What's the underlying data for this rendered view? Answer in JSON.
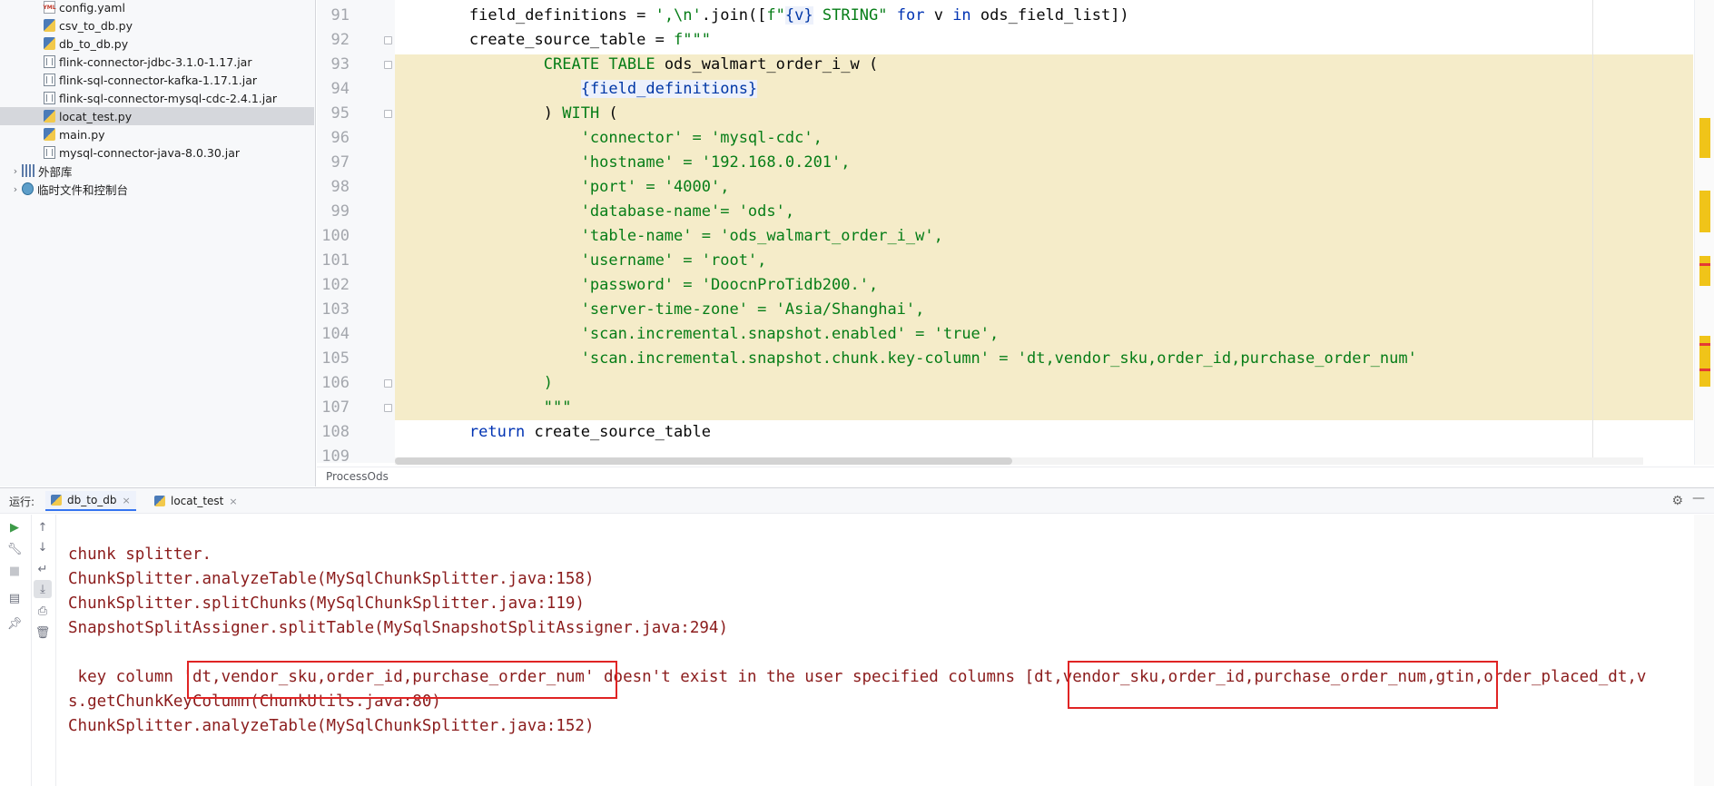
{
  "project_tree": {
    "items": [
      {
        "label": "config.yaml",
        "icon": "yaml-file-icon",
        "kind": "yaml",
        "indent": 2,
        "selected": false
      },
      {
        "label": "csv_to_db.py",
        "icon": "python-file-icon",
        "kind": "py",
        "indent": 2,
        "selected": false
      },
      {
        "label": "db_to_db.py",
        "icon": "python-file-icon",
        "kind": "py",
        "indent": 2,
        "selected": false
      },
      {
        "label": "flink-connector-jdbc-3.1.0-1.17.jar",
        "icon": "jar-file-icon",
        "kind": "jar",
        "indent": 2,
        "selected": false
      },
      {
        "label": "flink-sql-connector-kafka-1.17.1.jar",
        "icon": "jar-file-icon",
        "kind": "jar",
        "indent": 2,
        "selected": false
      },
      {
        "label": "flink-sql-connector-mysql-cdc-2.4.1.jar",
        "icon": "jar-file-icon",
        "kind": "jar",
        "indent": 2,
        "selected": false
      },
      {
        "label": "locat_test.py",
        "icon": "python-file-icon",
        "kind": "py",
        "indent": 2,
        "selected": true
      },
      {
        "label": "main.py",
        "icon": "python-file-icon",
        "kind": "py",
        "indent": 2,
        "selected": false
      },
      {
        "label": "mysql-connector-java-8.0.30.jar",
        "icon": "jar-file-icon",
        "kind": "jar",
        "indent": 2,
        "selected": false
      },
      {
        "label": "外部库",
        "icon": "library-icon",
        "kind": "lib",
        "indent": 1,
        "selected": false,
        "expandable": true
      },
      {
        "label": "临时文件和控制台",
        "icon": "scratches-icon",
        "kind": "scratch",
        "indent": 1,
        "selected": false,
        "expandable": true
      }
    ]
  },
  "editor": {
    "breadcrumb": "ProcessOds",
    "highlighted_block": {
      "from_line": 93,
      "to_line": 107
    },
    "lines": [
      {
        "number": "91",
        "tokens": [
          [
            "",
            "        field_definitions = "
          ],
          [
            "str",
            "',\\n'"
          ],
          [
            "",
            ".join(["
          ],
          [
            "fstr",
            "f\""
          ],
          [
            "interp",
            "{v}"
          ],
          [
            "fstr",
            " STRING\""
          ],
          [
            "kw",
            " for "
          ],
          [
            "",
            "v "
          ],
          [
            "kw",
            "in"
          ],
          [
            "",
            " ods_field_list])"
          ]
        ]
      },
      {
        "number": "92",
        "tokens": [
          [
            "",
            "        create_source_table = "
          ],
          [
            "fstr",
            "f\"\"\""
          ]
        ]
      },
      {
        "number": "93",
        "tokens": [
          [
            "str",
            "                CREATE TABLE "
          ],
          [
            "",
            "ods_walmart_order_i_w ("
          ]
        ]
      },
      {
        "number": "94",
        "tokens": [
          [
            "",
            "                    "
          ],
          [
            "interp",
            "{field_definitions}"
          ]
        ]
      },
      {
        "number": "95",
        "tokens": [
          [
            "",
            "                ) "
          ],
          [
            "str",
            "WITH"
          ],
          [
            "",
            " ("
          ]
        ]
      },
      {
        "number": "96",
        "tokens": [
          [
            "str",
            "                    'connector' = 'mysql-cdc',"
          ]
        ]
      },
      {
        "number": "97",
        "tokens": [
          [
            "str",
            "                    'hostname' = '192.168.0.201',"
          ]
        ]
      },
      {
        "number": "98",
        "tokens": [
          [
            "str",
            "                    'port' = '4000',"
          ]
        ]
      },
      {
        "number": "99",
        "tokens": [
          [
            "str",
            "                    'database-name'= 'ods',"
          ]
        ]
      },
      {
        "number": "100",
        "tokens": [
          [
            "str",
            "                    'table-name' = 'ods_walmart_order_i_w',"
          ]
        ]
      },
      {
        "number": "101",
        "tokens": [
          [
            "str",
            "                    'username' = 'root',"
          ]
        ]
      },
      {
        "number": "102",
        "tokens": [
          [
            "str",
            "                    'password' = 'DoocnProTidb200.',"
          ]
        ]
      },
      {
        "number": "103",
        "tokens": [
          [
            "str",
            "                    'server-time-zone' = 'Asia/Shanghai',"
          ]
        ]
      },
      {
        "number": "104",
        "tokens": [
          [
            "str",
            "                    'scan.incremental.snapshot.enabled' = 'true',"
          ]
        ]
      },
      {
        "number": "105",
        "tokens": [
          [
            "str",
            "                    'scan.incremental.snapshot.chunk.key-column' = 'dt,vendor_sku,order_id,purchase_order_num'"
          ]
        ]
      },
      {
        "number": "106",
        "tokens": [
          [
            "str",
            "                )"
          ]
        ]
      },
      {
        "number": "107",
        "tokens": [
          [
            "str",
            "                "
          ],
          [
            "fstr",
            "\"\"\""
          ]
        ]
      },
      {
        "number": "108",
        "tokens": [
          [
            "kw",
            "        return "
          ],
          [
            "",
            "create_source_table"
          ]
        ]
      },
      {
        "number": "109",
        "tokens": []
      }
    ]
  },
  "run_panel": {
    "label": "运行:",
    "tabs": [
      {
        "label": "db_to_db",
        "active": true
      },
      {
        "label": "locat_test",
        "active": false
      }
    ],
    "console_lines": [
      {
        "text": "chunk splitter."
      },
      {
        "text": "ChunkSplitter.analyzeTable(MySqlChunkSplitter.java:158)"
      },
      {
        "text": "ChunkSplitter.splitChunks(MySqlChunkSplitter.java:119)"
      },
      {
        "text": "SnapshotSplitAssigner.splitTable(MySqlSnapshotSplitAssigner.java:294)"
      },
      {
        "text": ""
      },
      {
        "text": " key column 'dt,vendor_sku,order_id,purchase_order_num' doesn't exist in the user specified columns [dt,vendor_sku,order_id,purchase_order_num,gtin,order_placed_dt,v"
      },
      {
        "text": "s.getChunkKeyColumn(ChunkUtils.java:80)"
      },
      {
        "text": "ChunkSplitter.analyzeTable(MySqlChunkSplitter.java:152)"
      }
    ]
  },
  "colors": {
    "keyword": "#0033b3",
    "string": "#067d17",
    "error_text": "#8b1c1c",
    "highlight_bg": "#f5ecc9",
    "annotation_box": "#e02424"
  }
}
